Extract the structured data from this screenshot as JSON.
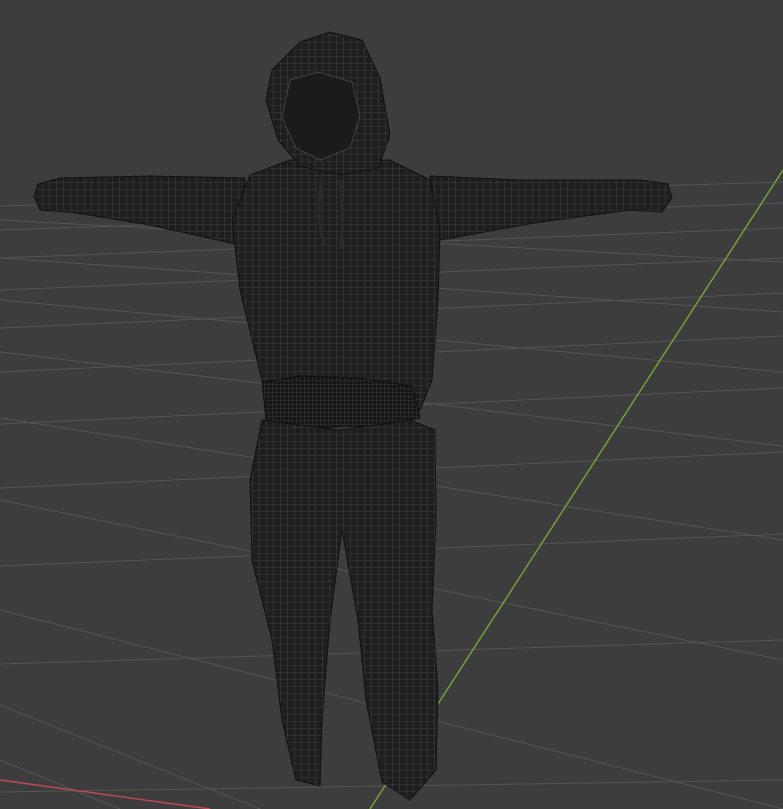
{
  "viewport": {
    "background": "#3d3d3d",
    "grid_color": "#555555",
    "y_axis_color": "#7aa33a",
    "x_axis_color": "#c04a56"
  },
  "model": {
    "mesh_fill": "#1e1e1e",
    "wire_color": "#4a4a4a",
    "display_mode": "wireframe"
  }
}
